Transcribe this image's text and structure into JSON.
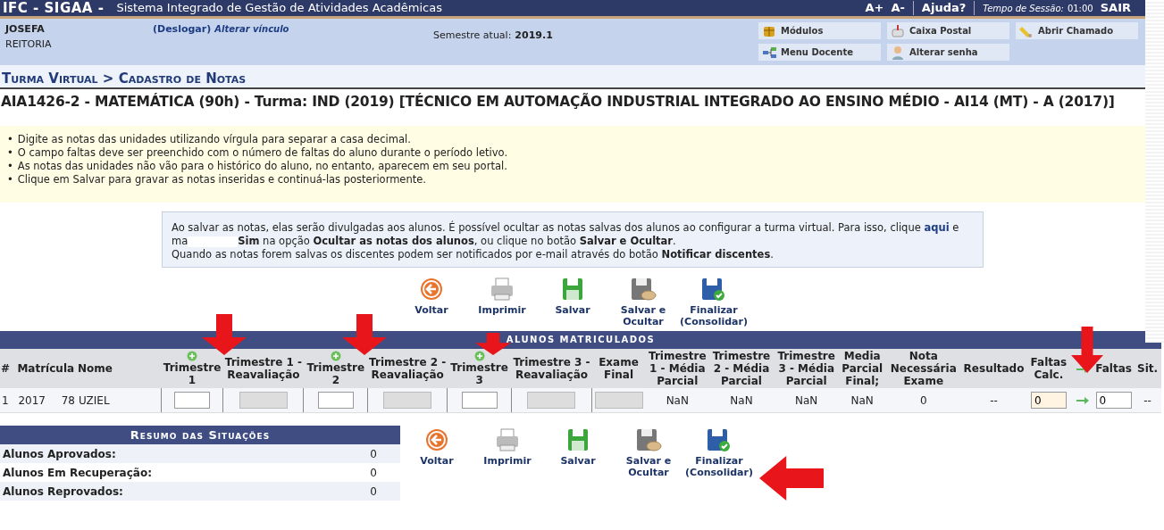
{
  "top_bar": {
    "brand": "IFC - SIGAA -",
    "system": "Sistema Integrado de Gestão de Atividades Acadêmicas",
    "font_up": "A+",
    "font_down": "A-",
    "help": "Ajuda?",
    "session_label": "Tempo de Sessão:",
    "session_time": "01:00",
    "logout": "SAIR"
  },
  "user": {
    "name": "JOSEFA",
    "unit": "REITORIA",
    "logout_link": "(Deslogar)",
    "change_link": "Alterar vínculo",
    "semester_label": "Semestre atual:",
    "semester": "2019.1"
  },
  "shortcuts": [
    {
      "label": "Módulos",
      "kind": "modules"
    },
    {
      "label": "Caixa Postal",
      "kind": "mail"
    },
    {
      "label": "Abrir Chamado",
      "kind": "ticket"
    },
    {
      "label": "Menu Docente",
      "kind": "menu"
    },
    {
      "label": "Alterar senha",
      "kind": "password"
    }
  ],
  "breadcrumb": "Turma Virtual > Cadastro de Notas",
  "course_title": "AIA1426-2 - MATEMÁTICA (90h) - Turma: IND (2019) [TÉCNICO EM AUTOMAÇÃO INDUSTRIAL INTEGRADO AO ENSINO MÉDIO - AI14 (MT) - A (2017)]",
  "instructions": [
    {
      "marker": "•",
      "text": "Digite as notas das unidades utilizando vírgula para separar a casa decimal."
    },
    {
      "marker": "•",
      "text": "O campo faltas deve ser preenchido com o número de faltas do aluno durante o período letivo."
    },
    {
      "marker": "•",
      "text": "As notas das unidades não vão para o histórico do aluno, no entanto, aparecem em seu portal."
    },
    {
      "marker": "•",
      "text": "Clique em Salvar para gravar as notas inseridas e continuá-las posteriormente."
    }
  ],
  "notice": {
    "paragraphs": [
      [
        {
          "kind": "text",
          "text": "Ao salvar as notas, elas serão divulgadas aos alunos. É possível ocultar as notas salvas dos alunos ao configurar a turma virtual. Para isso, clique "
        },
        {
          "kind": "link",
          "text": "aqui"
        },
        {
          "kind": "text",
          "text": " e ma"
        },
        {
          "kind": "redacted"
        },
        {
          "kind": "bold",
          "text": "Sim"
        },
        {
          "kind": "text",
          "text": " na opção "
        },
        {
          "kind": "bold",
          "text": "Ocultar as notas dos alunos"
        },
        {
          "kind": "text",
          "text": ", ou clique no botão "
        },
        {
          "kind": "bold",
          "text": "Salvar e Ocultar"
        },
        {
          "kind": "text",
          "text": "."
        }
      ],
      [
        {
          "kind": "text",
          "text": "Quando as notas forem salvas os discentes podem ser notificados por e-mail através do botão "
        },
        {
          "kind": "bold",
          "text": "Notificar discentes"
        },
        {
          "kind": "text",
          "text": "."
        }
      ]
    ]
  },
  "top_toolbar": [
    {
      "label": "Voltar",
      "kind": "back"
    },
    {
      "label": "Imprimir",
      "kind": "print"
    },
    {
      "label": "Salvar",
      "kind": "save"
    },
    {
      "label": "Salvar e Ocultar",
      "kind": "save_hide"
    },
    {
      "label": "Finalizar (Consolidar)",
      "kind": "finalize"
    }
  ],
  "table": {
    "title": "ALUNOS MATRICULADOS",
    "columns": [
      {
        "label": "#",
        "kind": "plain"
      },
      {
        "label": "Matrícula",
        "kind": "plain"
      },
      {
        "label": "Nome",
        "kind": "plain"
      },
      {
        "label": "Trimestre 1",
        "kind": "add"
      },
      {
        "label": "Trimestre 1 - Reavaliação",
        "kind": "plain"
      },
      {
        "label": "Trimestre 2",
        "kind": "add"
      },
      {
        "label": "Trimestre 2 - Reavaliação",
        "kind": "plain"
      },
      {
        "label": "Trimestre 3",
        "kind": "add"
      },
      {
        "label": "Trimestre 3 - Reavaliação",
        "kind": "plain"
      },
      {
        "label": "Exame Final",
        "kind": "plain"
      },
      {
        "label": "Trimestre 1 - Média Parcial",
        "kind": "plain"
      },
      {
        "label": "Trimestre 2 - Média Parcial",
        "kind": "plain"
      },
      {
        "label": "Trimestre 3 - Média Parcial",
        "kind": "plain"
      },
      {
        "label": "Media Parcial Final;",
        "kind": "plain"
      },
      {
        "label": "Nota Necessária Exame",
        "kind": "plain"
      },
      {
        "label": "Resultado",
        "kind": "plain"
      },
      {
        "label": "Faltas Calc.",
        "kind": "plain"
      },
      {
        "kind": "arrow"
      },
      {
        "label": "Faltas",
        "kind": "plain"
      },
      {
        "label": "Sit.",
        "kind": "plain"
      }
    ],
    "rows": [
      {
        "cells": [
          {
            "kind": "text",
            "value": "1"
          },
          {
            "kind": "split",
            "parts": [
              "2017",
              "78"
            ]
          },
          {
            "kind": "text",
            "value": "UZIEL"
          },
          {
            "kind": "input"
          },
          {
            "kind": "input_disabled"
          },
          {
            "kind": "input"
          },
          {
            "kind": "input_disabled"
          },
          {
            "kind": "input"
          },
          {
            "kind": "input_disabled"
          },
          {
            "kind": "input_disabled"
          },
          {
            "kind": "text",
            "value": "NaN"
          },
          {
            "kind": "text",
            "value": "NaN"
          },
          {
            "kind": "text",
            "value": "NaN"
          },
          {
            "kind": "text",
            "value": "NaN"
          },
          {
            "kind": "text",
            "value": "0"
          },
          {
            "kind": "text",
            "value": "--"
          },
          {
            "kind": "input_calc",
            "value": "0"
          },
          {
            "kind": "arrow"
          },
          {
            "kind": "input",
            "value": "0"
          },
          {
            "kind": "text",
            "value": "--"
          }
        ]
      }
    ]
  },
  "summary": {
    "title": "Resumo das Situações",
    "rows": [
      {
        "label": "Alunos Aprovados:",
        "value": "0"
      },
      {
        "label": "Alunos Em Recuperação:",
        "value": "0"
      },
      {
        "label": "Alunos Reprovados:",
        "value": "0"
      }
    ]
  },
  "bottom_toolbar": [
    {
      "label": "Voltar",
      "kind": "back"
    },
    {
      "label": "Imprimir",
      "kind": "print"
    },
    {
      "label": "Salvar",
      "kind": "save"
    },
    {
      "label": "Salvar e Ocultar",
      "kind": "save_hide"
    },
    {
      "label": "Finalizar (Consolidar)",
      "kind": "finalize"
    }
  ],
  "annotations": [
    {
      "kind": "down"
    },
    {
      "kind": "down"
    },
    {
      "kind": "down"
    },
    {
      "kind": "down"
    },
    {
      "kind": "left"
    }
  ]
}
